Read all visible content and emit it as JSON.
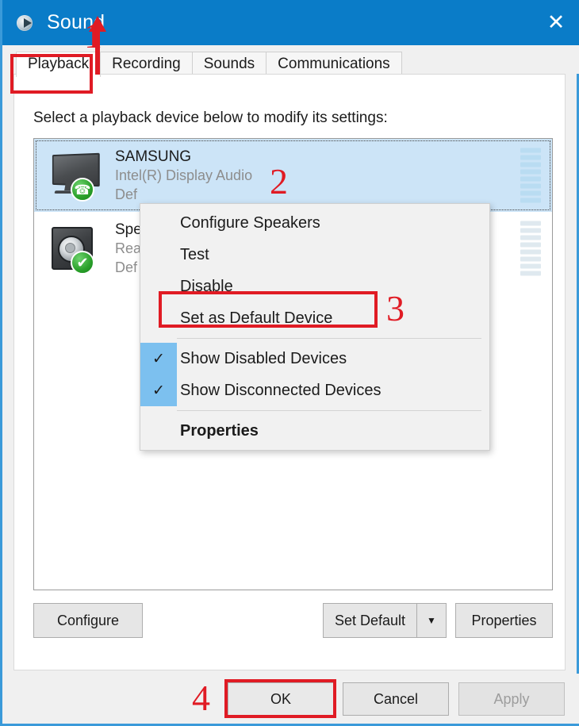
{
  "window": {
    "title": "Sound",
    "title_icon": "speaker-icon",
    "close_label": "✕"
  },
  "tabs": [
    {
      "label": "Playback",
      "active": true
    },
    {
      "label": "Recording",
      "active": false
    },
    {
      "label": "Sounds",
      "active": false
    },
    {
      "label": "Communications",
      "active": false
    }
  ],
  "main": {
    "prompt": "Select a playback device below to modify its settings:"
  },
  "devices": [
    {
      "name": "SAMSUNG",
      "driver": "Intel(R) Display Audio",
      "status": "Def",
      "icon": "monitor-icon",
      "badge": "phone-badge-icon",
      "badge_glyph": "☎",
      "selected": true
    },
    {
      "name": "Spe",
      "driver": "Rea",
      "status": "Def",
      "icon": "speaker-icon",
      "badge": "check-badge-icon",
      "badge_glyph": "✔",
      "selected": false
    }
  ],
  "context_menu": {
    "items": [
      {
        "label": "Configure Speakers",
        "checked": false,
        "bold": false,
        "separator_after": false
      },
      {
        "label": "Test",
        "checked": false,
        "bold": false,
        "separator_after": false
      },
      {
        "label": "Disable",
        "checked": false,
        "bold": false,
        "separator_after": false
      },
      {
        "label": "Set as Default Device",
        "checked": false,
        "bold": false,
        "separator_after": true
      },
      {
        "label": "Show Disabled Devices",
        "checked": true,
        "bold": false,
        "separator_after": false
      },
      {
        "label": "Show Disconnected Devices",
        "checked": true,
        "bold": false,
        "separator_after": true
      },
      {
        "label": "Properties",
        "checked": false,
        "bold": true,
        "separator_after": false
      }
    ],
    "check_glyph": "✓"
  },
  "mid_buttons": {
    "configure": "Configure",
    "set_default": "Set Default",
    "set_default_arrow": "▼",
    "properties": "Properties"
  },
  "footer_buttons": {
    "ok": "OK",
    "cancel": "Cancel",
    "apply": "Apply",
    "apply_disabled": true
  },
  "annotations": {
    "step1": "1",
    "step2": "2",
    "step3": "3",
    "step4": "4",
    "color": "#e01b24"
  }
}
